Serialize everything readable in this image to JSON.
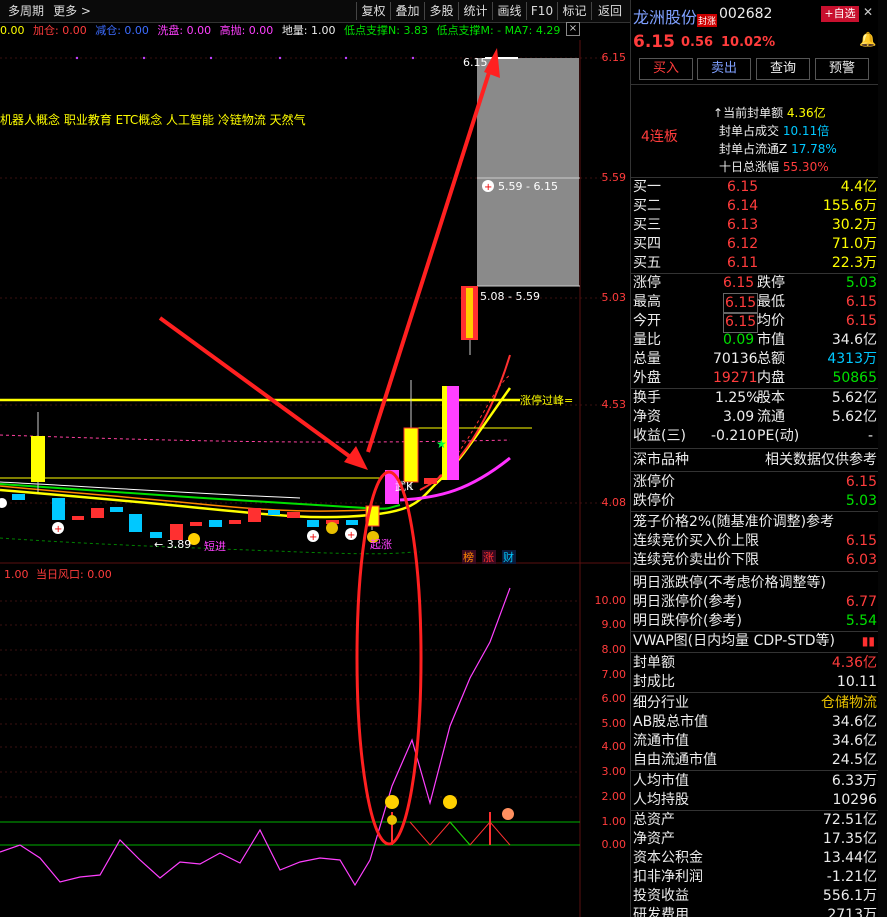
{
  "toolbar": {
    "left": [
      "多周期",
      "更多 >"
    ],
    "right": [
      "复权",
      "叠加",
      "多股",
      "统计",
      "画线",
      "F10",
      "标记",
      "返回"
    ]
  },
  "indicators": [
    {
      "label": "0.00",
      "color": "#ffff00"
    },
    {
      "label": "加仓: 0.00",
      "color": "#ff3c3c"
    },
    {
      "label": "减仓: 0.00",
      "color": "#3c6cff"
    },
    {
      "label": "洗盘: 0.00",
      "color": "#ff40ff"
    },
    {
      "label": "高抛: 0.00",
      "color": "#ff40ff"
    },
    {
      "label": "地量: 1.00",
      "color": "#ececec"
    },
    {
      "label": "低点支撑N: 3.83",
      "color": "#00e000"
    },
    {
      "label": "低点支撑M: - MA7: 4.29",
      "color": "#00e000"
    }
  ],
  "concepts": "机器人概念 职业教育 ETC概念 人工智能 冷链物流 天然气",
  "price_axis": [
    "6.15",
    "5.59",
    "5.03",
    "4.53",
    "4.08"
  ],
  "sub_axis": [
    "10.00",
    "9.00",
    "8.00",
    "7.00",
    "6.00",
    "5.00",
    "4.00",
    "3.00",
    "2.00",
    "1.00",
    "0.00"
  ],
  "chart_labels": {
    "gap_top": "5.59 - 6.15",
    "gap_bottom": "5.08 - 5.59",
    "limit_line": "涨停过峰=",
    "low_mark": "← 3.89",
    "text_jiajin": "短进",
    "text_qizhang": "起涨",
    "text_wuzhang": "武K",
    "top_label": "6.15",
    "badge_bang": "榜",
    "badge_zhang": "涨",
    "badge_cai": "财"
  },
  "sub_label": {
    "a": "1.00",
    "b": "当日风口: 0.00"
  },
  "stock": {
    "name": "龙洲股份",
    "tag": "封涨",
    "code": "002682",
    "add_button": "+自选",
    "price": "6.15",
    "change": "0.56",
    "pct": "10.02%"
  },
  "actions": [
    "买入",
    "卖出",
    "查询",
    "预警"
  ],
  "seal": {
    "badge": "4连板",
    "rows": [
      {
        "label": "当前封单额",
        "value": "4.36亿"
      },
      {
        "label": "封单占成交",
        "value": "10.11倍"
      },
      {
        "label": "封单占流通Z",
        "value": "17.78%"
      },
      {
        "label": "十日总涨幅",
        "value": "55.30%"
      }
    ]
  },
  "bids": [
    {
      "label": "买一",
      "price": "6.15",
      "vol": "4.4亿"
    },
    {
      "label": "买二",
      "price": "6.14",
      "vol": "155.6万"
    },
    {
      "label": "买三",
      "price": "6.13",
      "vol": "30.2万"
    },
    {
      "label": "买四",
      "price": "6.12",
      "vol": "71.0万"
    },
    {
      "label": "买五",
      "price": "6.11",
      "vol": "22.3万"
    }
  ],
  "quote": [
    {
      "l1": "涨停",
      "v1": "6.15",
      "c1": "red",
      "l2": "跌停",
      "v2": "5.03",
      "c2": "green"
    },
    {
      "l1": "最高",
      "v1": "6.15",
      "c1": "red",
      "l2": "最低",
      "v2": "6.15",
      "c2": "red",
      "box": true
    },
    {
      "l1": "今开",
      "v1": "6.15",
      "c1": "red",
      "l2": "均价",
      "v2": "6.15",
      "c2": "red",
      "box": true
    },
    {
      "l1": "量比",
      "v1": "0.09",
      "c1": "green",
      "l2": "市值",
      "v2": "34.6亿",
      "c2": "white"
    },
    {
      "l1": "总量",
      "v1": "70136",
      "c1": "white",
      "l2": "总额",
      "v2": "4313万",
      "c2": "cyan"
    },
    {
      "l1": "外盘",
      "v1": "19271",
      "c1": "red",
      "l2": "内盘",
      "v2": "50865",
      "c2": "green"
    }
  ],
  "fin": [
    {
      "l1": "换手",
      "v1": "1.25%",
      "l2": "股本",
      "v2": "5.62亿"
    },
    {
      "l1": "净资",
      "v1": "3.09",
      "l2": "流通",
      "v2": "5.62亿"
    },
    {
      "l1": "收益(三)",
      "v1": "-0.210",
      "l2": "PE(动)",
      "v2": "-"
    }
  ],
  "market": {
    "left": "深市品种",
    "right": "相关数据仅供参考"
  },
  "limits": [
    {
      "label": "涨停价",
      "value": "6.15",
      "color": "red"
    },
    {
      "label": "跌停价",
      "value": "5.03",
      "color": "green"
    }
  ],
  "cage": {
    "title": "笼子价格2%(随基准价调整)参考",
    "rows": [
      {
        "label": "连续竞价买入价上限",
        "value": "6.15",
        "color": "red"
      },
      {
        "label": "连续竞价卖出价下限",
        "value": "6.03",
        "color": "red"
      }
    ]
  },
  "tomorrow": {
    "title": "明日涨跌停(不考虑价格调整等)",
    "rows": [
      {
        "label": "明日涨停价(参考)",
        "value": "6.77",
        "color": "red"
      },
      {
        "label": "明日跌停价(参考)",
        "value": "5.54",
        "color": "green"
      }
    ]
  },
  "vwap": {
    "title": "VWAP图(日内均量 CDP-STD等)"
  },
  "seal2": [
    {
      "label": "封单额",
      "value": "4.36亿",
      "color": "red"
    },
    {
      "label": "封成比",
      "value": "10.11",
      "color": "white"
    }
  ],
  "industry": {
    "label": "细分行业",
    "value": "仓储物流"
  },
  "stats": [
    {
      "label": "AB股总市值",
      "value": "34.6亿"
    },
    {
      "label": "流通市值",
      "value": "34.6亿"
    },
    {
      "label": "自由流通市值",
      "value": "24.5亿"
    },
    {
      "label": "人均市值",
      "value": "6.33万"
    },
    {
      "label": "人均持股",
      "value": "10296"
    },
    {
      "label": "总资产",
      "value": "72.51亿"
    },
    {
      "label": "净资产",
      "value": "17.35亿"
    },
    {
      "label": "资本公积金",
      "value": "13.44亿"
    },
    {
      "label": "扣非净利润",
      "value": "-1.21亿"
    },
    {
      "label": "投资收益",
      "value": "556.1万"
    },
    {
      "label": "研发费用",
      "value": "2713万"
    }
  ]
}
